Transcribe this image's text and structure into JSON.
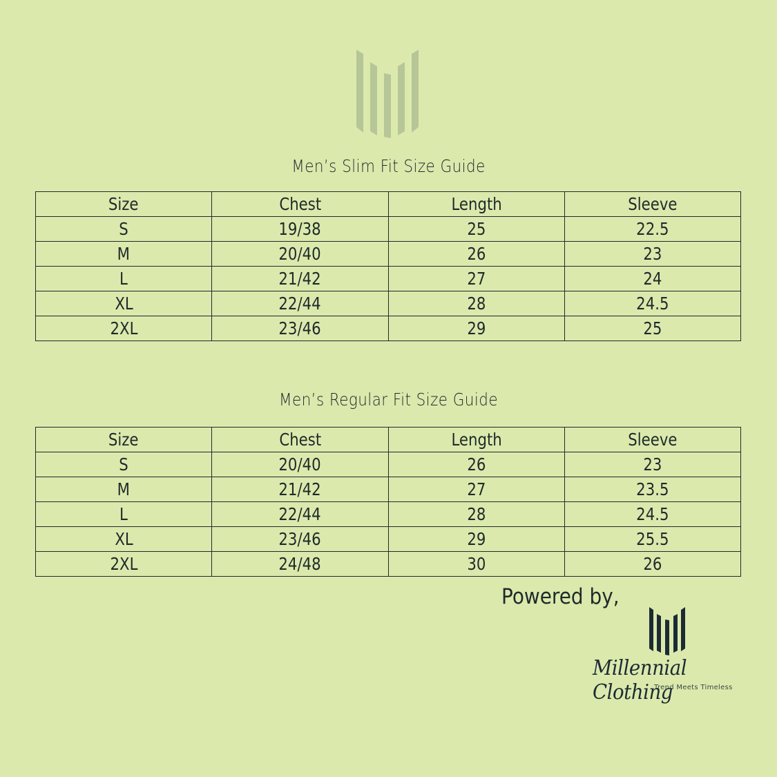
{
  "logo_top": {
    "icon": "bars-logo-icon",
    "color": "#b6c697"
  },
  "tables": [
    {
      "title": "Men’s Slim Fit Size Guide",
      "headers": [
        "Size",
        "Chest",
        "Length",
        "Sleeve"
      ],
      "rows": [
        [
          "S",
          "19/38",
          "25",
          "22.5"
        ],
        [
          "M",
          "20/40",
          "26",
          "23"
        ],
        [
          "L",
          "21/42",
          "27",
          "24"
        ],
        [
          "XL",
          "22/44",
          "28",
          "24.5"
        ],
        [
          "2XL",
          "23/46",
          "29",
          "25"
        ]
      ]
    },
    {
      "title": "Men’s Regular Fit Size Guide",
      "headers": [
        "Size",
        "Chest",
        "Length",
        "Sleeve"
      ],
      "rows": [
        [
          "S",
          "20/40",
          "26",
          "23"
        ],
        [
          "M",
          "21/42",
          "27",
          "23.5"
        ],
        [
          "L",
          "22/44",
          "28",
          "24.5"
        ],
        [
          "XL",
          "23/46",
          "29",
          "25.5"
        ],
        [
          "2XL",
          "24/48",
          "30",
          "26"
        ]
      ]
    }
  ],
  "footer": {
    "powered_by": "Powered by,",
    "brand_name": "Millennial Clothing",
    "tagline": "Trend Meets Timeless",
    "logo_icon": "bars-logo-icon",
    "logo_color": "#1c2b33"
  },
  "colors": {
    "background": "#dbe9ad",
    "text": "#1f2a2a"
  }
}
